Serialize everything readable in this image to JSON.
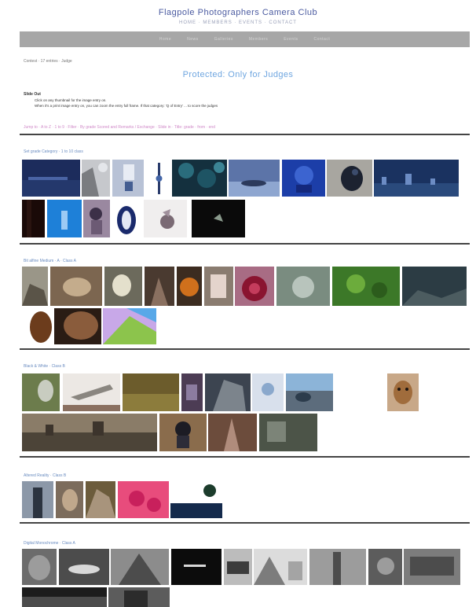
{
  "header": {
    "title": "Flagpole Photographers Camera Club",
    "subtitle": "HOME · MEMBERS · EVENTS · CONTACT"
  },
  "nav": {
    "items": [
      "Home",
      "News",
      "Galleries",
      "Members",
      "Events",
      "Contact"
    ]
  },
  "breadcrumb": "Contest · 17 entries · Judge",
  "page_title": "Protected: Only for Judges",
  "intro": {
    "heading": "Slide Out",
    "line1": "Click on any thumbnail for the image entry on.",
    "line2": "When it's a print image entry on, you can zoom the entry full frame. If that category: 'Q of Entry' ... to score the judges"
  },
  "filter_link": "Jump to · A to Z · 1 to 9 · Filter · By grade Scored and Remarks / Exchange · Slide in · Title: grade · from · end",
  "sections": [
    {
      "title": "Set grade Category · 1 to 10 class"
    },
    {
      "title": "Bit alfine Medium · A · Class A"
    },
    {
      "title": "Black & White · Class B"
    },
    {
      "title": "Altered Reality · Class B"
    },
    {
      "title": "Digital Monochrome · Class A"
    }
  ],
  "colors": {
    "nav_bg": "#a7a7a7",
    "title": "#4a5aa0",
    "page_title": "#6fa6e0",
    "link": "#d08ac8",
    "divider": "#444444"
  }
}
